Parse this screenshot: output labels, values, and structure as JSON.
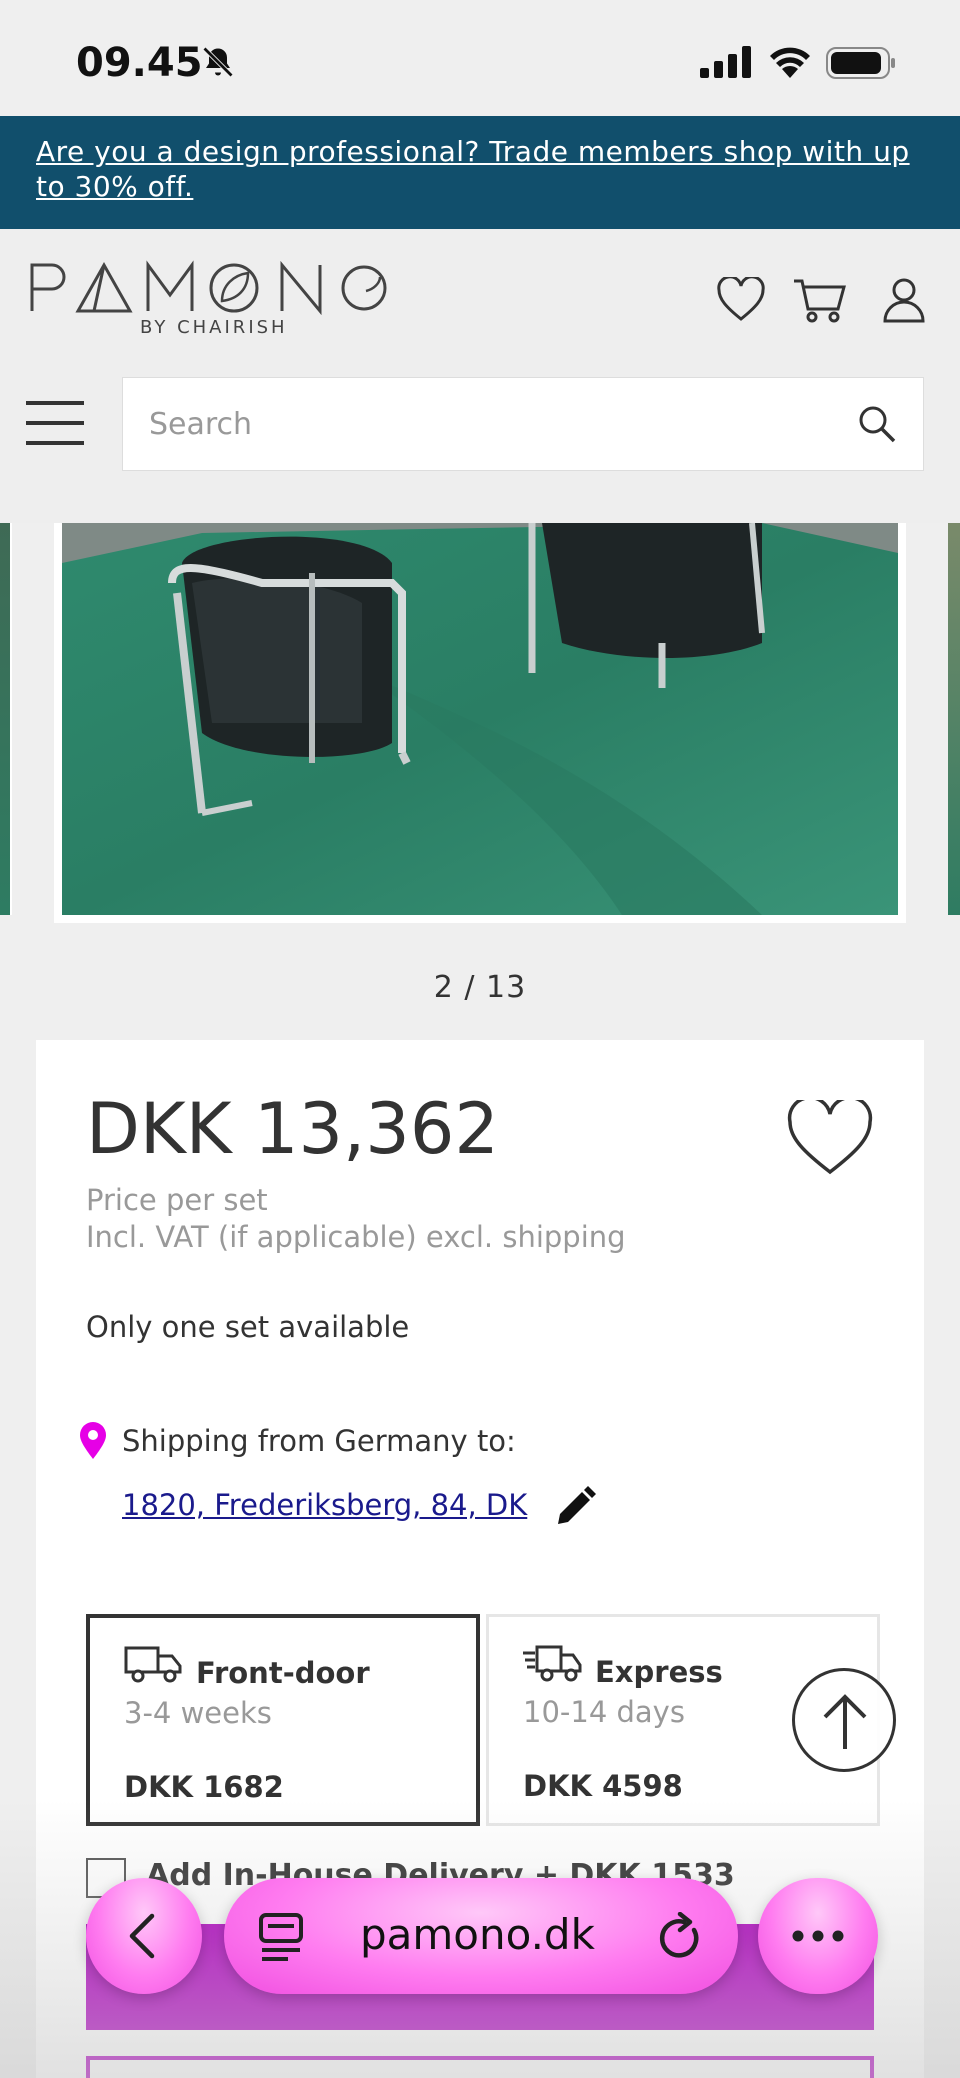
{
  "status_bar": {
    "time": "09.45"
  },
  "banner": {
    "text": "Are you a design professional? Trade members shop with up to 30% off."
  },
  "header": {
    "logo_text": "PAMONO",
    "logo_sub": "BY CHAIRISH",
    "search_placeholder": "Search",
    "icons": [
      "heart-icon",
      "cart-icon",
      "user-icon",
      "menu-icon",
      "search-icon"
    ]
  },
  "gallery": {
    "counter": "2 / 13"
  },
  "product": {
    "price": "DKK 13,362",
    "price_unit": "Price per set",
    "price_note": "Incl. VAT (if applicable) excl. shipping",
    "availability": "Only one set available",
    "shipping_from": "Shipping from Germany to:",
    "shipping_to": "1820, Frederiksberg, 84, DK"
  },
  "delivery_options": [
    {
      "name": "Front-door",
      "time": "3-4 weeks",
      "cost": "DKK 1682",
      "selected": true
    },
    {
      "name": "Express",
      "time": "10-14 days",
      "cost": "DKK 4598",
      "selected": false
    }
  ],
  "in_house": {
    "label": "Add In-House Delivery + DKK 1533"
  },
  "browser": {
    "url": "pamono.dk"
  },
  "colors": {
    "banner_bg": "#114f6c",
    "accent": "#b000c0",
    "browser_pill": "#ff7cf0",
    "pin": "#e600e6"
  }
}
